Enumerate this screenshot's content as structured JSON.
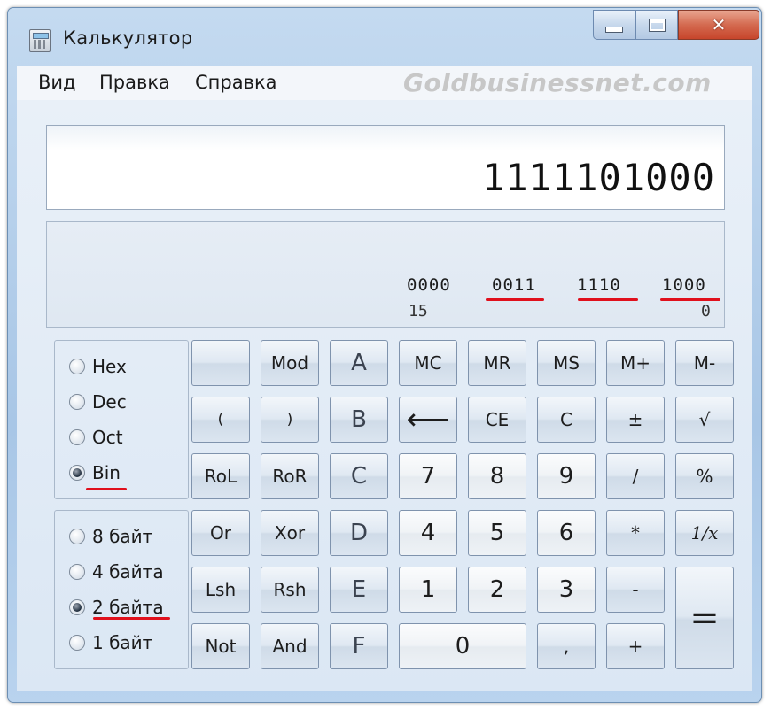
{
  "window": {
    "title": "Калькулятор"
  },
  "menu": [
    {
      "label": "Вид"
    },
    {
      "label": "Правка"
    },
    {
      "label": "Справка"
    }
  ],
  "watermark": "Goldbusinessnet.com",
  "display": {
    "value": "1111101000",
    "nibbles": [
      "0000",
      "0011",
      "1110",
      "1000"
    ],
    "bit_labels": [
      "15",
      "0"
    ]
  },
  "base_modes": [
    {
      "label": "Hex",
      "checked": false
    },
    {
      "label": "Dec",
      "checked": false
    },
    {
      "label": "Oct",
      "checked": false
    },
    {
      "label": "Bin",
      "checked": true
    }
  ],
  "word_sizes": [
    {
      "label": "8 байт",
      "checked": false
    },
    {
      "label": "4 байта",
      "checked": false
    },
    {
      "label": "2 байта",
      "checked": true
    },
    {
      "label": "1 байт",
      "checked": false
    }
  ],
  "keys": {
    "blank": "",
    "mod": "Mod",
    "a": "A",
    "mc": "MC",
    "mr": "MR",
    "ms": "MS",
    "mplus": "M+",
    "mminus": "M-",
    "lparen": "(",
    "rparen": ")",
    "b": "B",
    "backspace": "⟵",
    "ce": "CE",
    "c": "C",
    "plusminus": "±",
    "sqrt": "√",
    "rol": "RoL",
    "ror": "RoR",
    "hc": "C",
    "d7": "7",
    "d8": "8",
    "d9": "9",
    "divide": "/",
    "percent": "%",
    "or": "Or",
    "xor": "Xor",
    "d": "D",
    "d4": "4",
    "d5": "5",
    "d6": "6",
    "multiply": "*",
    "reciprocal": "1/x",
    "lsh": "Lsh",
    "rsh": "Rsh",
    "e": "E",
    "d1": "1",
    "d2": "2",
    "d3": "3",
    "minus": "-",
    "equals": "=",
    "not": "Not",
    "and": "And",
    "f": "F",
    "d0": "0",
    "decimal": ",",
    "plus": "+"
  },
  "colors": {
    "highlight_underline": "#e0101c",
    "close_button": "#d46a50"
  }
}
